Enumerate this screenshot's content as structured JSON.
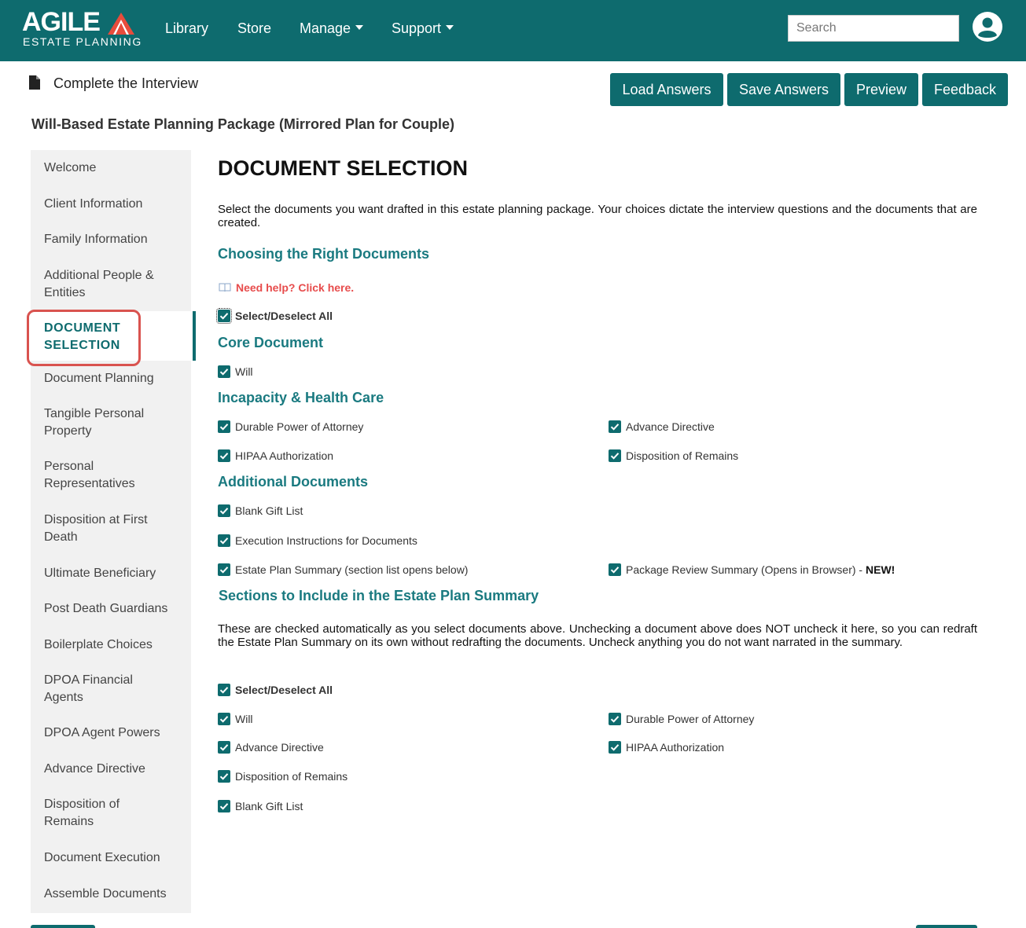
{
  "brand": {
    "name": "AGILE",
    "tagline": "ESTATE PLANNING",
    "accent": "#e74c3c",
    "primary": "#0e6b6e"
  },
  "nav": {
    "library": "Library",
    "store": "Store",
    "manage": "Manage",
    "support": "Support",
    "search_placeholder": "Search",
    "user_icon": "user-circle-icon"
  },
  "header": {
    "heading": "Complete the Interview",
    "buttons": {
      "load": "Load Answers",
      "save": "Save Answers",
      "preview": "Preview",
      "feedback": "Feedback"
    },
    "package_title": "Will-Based Estate Planning Package (Mirrored Plan for Couple)"
  },
  "sidebar": {
    "items": [
      "Welcome",
      "Client Information",
      "Family Information",
      "Additional People & Entities",
      "DOCUMENT SELECTION",
      "Document Planning",
      "Tangible Personal Property",
      "Personal Representatives",
      "Disposition at First Death",
      "Ultimate Beneficiary",
      "Post Death Guardians",
      "Boilerplate Choices",
      "DPOA Financial Agents",
      "DPOA Agent Powers",
      "Advance Directive",
      "Disposition of Remains",
      "Document Execution",
      "Assemble Documents"
    ],
    "active_index": 4
  },
  "main": {
    "title": "DOCUMENT SELECTION",
    "intro": "Select the documents you want drafted in this estate planning package. Your choices dictate the interview questions and the documents that are created.",
    "choosing_heading": "Choosing the Right Documents",
    "help_link": "Need help? Click here.",
    "select_all": "Select/Deselect All",
    "core_heading": "Core Document",
    "core_items": {
      "will": "Will"
    },
    "incapacity_heading": "Incapacity & Health Care",
    "incapacity_items": {
      "dpoa": "Durable Power of Attorney",
      "advance_directive": "Advance Directive",
      "hipaa": "HIPAA Authorization",
      "remains": "Disposition of Remains"
    },
    "additional_heading": "Additional Documents",
    "additional_items": {
      "gift_list": "Blank Gift List",
      "execution": "Execution Instructions for Documents",
      "summary": "Estate Plan Summary (section list opens below)",
      "review": "Package Review Summary (Opens in Browser) - ",
      "new_tag": "NEW!"
    },
    "summary_heading": "Sections to Include in the Estate Plan Summary",
    "summary_intro": "These are checked automatically as you select documents above. Unchecking a document above does NOT uncheck it here, so you can redraft the Estate Plan Summary on its own without redrafting the documents. Uncheck anything you do not want narrated in the summary.",
    "summary_select_all": "Select/Deselect All",
    "summary_items": {
      "will": "Will",
      "dpoa": "Durable Power of Attorney",
      "advance_directive": "Advance Directive",
      "hipaa": "HIPAA Authorization",
      "remains": "Disposition of Remains",
      "gift_list": "Blank Gift List"
    }
  }
}
